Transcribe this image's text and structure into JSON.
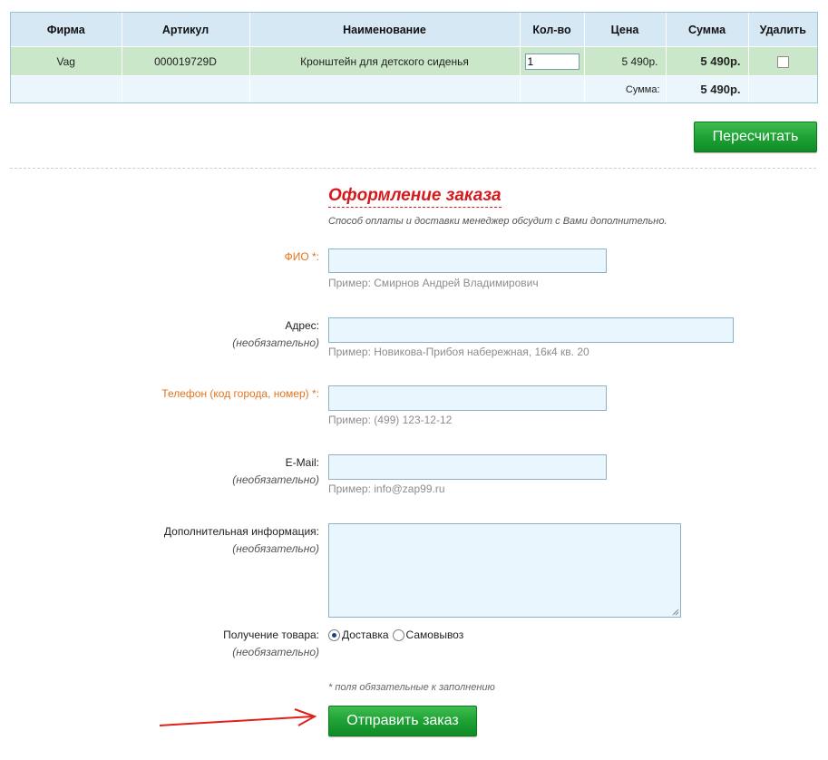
{
  "cart": {
    "headers": [
      "Фирма",
      "Артикул",
      "Наименование",
      "Кол-во",
      "Цена",
      "Сумма",
      "Удалить"
    ],
    "rows": [
      {
        "firm": "Vag",
        "article": "000019729D",
        "name": "Кронштейн для детского сиденья",
        "qty": "1",
        "price": "5 490р.",
        "sum": "5 490р."
      }
    ],
    "total_label": "Сумма:",
    "total_value": "5 490р."
  },
  "recalc_button": "Пересчитать",
  "form": {
    "title": "Оформление заказа",
    "subtitle": "Способ оплаты и доставки менеджер обсудит с Вами дополнительно.",
    "optional_note": "(необязательно)",
    "fio": {
      "label": "ФИО *:",
      "hint": "Пример: Смирнов Андрей Владимирович"
    },
    "address": {
      "label": "Адрес:",
      "hint": "Пример: Новикова-Прибоя набережная, 16к4 кв. 20"
    },
    "phone": {
      "label": "Телефон (код города, номер) *:",
      "hint": "Пример: (499) 123-12-12"
    },
    "email": {
      "label": "E-Mail:",
      "hint": "Пример: info@zap99.ru"
    },
    "extra": {
      "label": "Дополнительная информация:"
    },
    "delivery": {
      "label": "Получение товара:",
      "options": [
        "Доставка",
        "Самовывоз"
      ],
      "selected": "Доставка"
    },
    "required_note": "* поля обязательные к заполнению",
    "submit": "Отправить заказ"
  },
  "colors": {
    "accent_red": "#d6191c",
    "required_orange": "#e3741e",
    "button_green": "#1ea235"
  }
}
